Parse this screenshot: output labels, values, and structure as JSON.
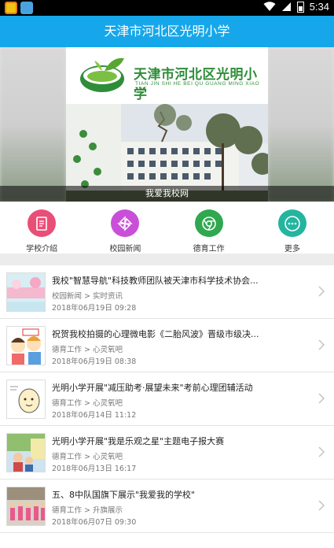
{
  "status_bar": {
    "time": "5:34",
    "icons": [
      "app-notification-icon",
      "app-notification-icon",
      "wifi-icon",
      "signal-icon",
      "battery-icon"
    ]
  },
  "app": {
    "title": "天津市河北区光明小学"
  },
  "banner": {
    "logo_title": "天津市河北区光明小学",
    "logo_subtitle": "TIAN JIN SHI HE BEI QU GUANG MING XIAO XUE",
    "caption": "我爱我校网"
  },
  "quick_nav": [
    {
      "label": "学校介绍",
      "icon": "document-icon",
      "color": "#e94e77"
    },
    {
      "label": "校园新闻",
      "icon": "pinwheel-icon",
      "color": "#c94fd8"
    },
    {
      "label": "德育工作",
      "icon": "chrome-circle-icon",
      "color": "#2fa84f"
    },
    {
      "label": "更多",
      "icon": "more-dots-icon",
      "color": "#23b5a0"
    }
  ],
  "news": [
    {
      "title": "我校\"智慧导航\"科技教师团队被天津市科学技术协会...",
      "category": "校园新闻 > 实时资讯",
      "date": "2018年06月19日 09:28"
    },
    {
      "title": "祝贺我校拍摄的心理微电影《二胎风波》晋级市级决...",
      "category": "德育工作 > 心灵氧吧",
      "date": "2018年06月19日 08:38"
    },
    {
      "title": "光明小学开展\"减压助考·展望未来\"考前心理团辅活动",
      "category": "德育工作 > 心灵氧吧",
      "date": "2018年06月14日 11:12"
    },
    {
      "title": "光明小学开展\"我是乐观之星\"主题电子报大赛",
      "category": "德育工作 > 心灵氧吧",
      "date": "2018年06月13日 16:17"
    },
    {
      "title": "五、8中队国旗下展示\"我爱我的学校\"",
      "category": "德育工作 > 升旗展示",
      "date": "2018年06月07日 09:30"
    }
  ]
}
